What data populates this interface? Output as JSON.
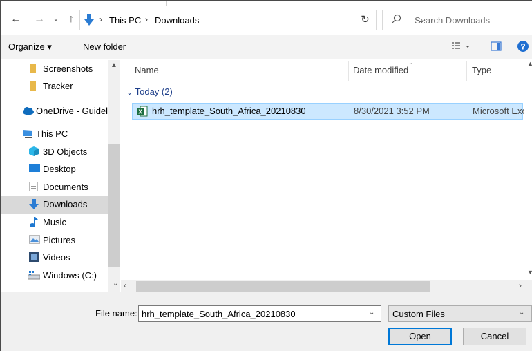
{
  "address_bar": {
    "back_icon": "arrow-left-icon",
    "forward_icon": "arrow-right-icon",
    "recent_icon": "chevron-down-icon",
    "up_icon": "arrow-up-icon",
    "location_icon": "downloads-icon",
    "crumbs": [
      "This PC",
      "Downloads"
    ],
    "separator": "›",
    "dropdown_icon": "chevron-down-icon",
    "refresh_icon": "refresh-icon",
    "refresh_glyph": "↻",
    "search_placeholder": "Search Downloads"
  },
  "toolbar": {
    "organize_label": "Organize ▾",
    "new_folder_label": "New folder",
    "view_icon": "view-options-icon",
    "preview_icon": "preview-pane-icon",
    "help_icon": "help-icon",
    "help_glyph": "?"
  },
  "nav": {
    "items": [
      {
        "label": "Screenshots",
        "icon": "folder-icon"
      },
      {
        "label": "Tracker",
        "icon": "folder-icon"
      },
      {
        "label": "OneDrive - Guidel",
        "icon": "onedrive-icon"
      },
      {
        "label": "This PC",
        "icon": "computer-icon"
      },
      {
        "label": "3D Objects",
        "icon": "3d-objects-icon"
      },
      {
        "label": "Desktop",
        "icon": "desktop-icon"
      },
      {
        "label": "Documents",
        "icon": "documents-icon"
      },
      {
        "label": "Downloads",
        "icon": "downloads-icon",
        "selected": true
      },
      {
        "label": "Music",
        "icon": "music-icon"
      },
      {
        "label": "Pictures",
        "icon": "pictures-icon"
      },
      {
        "label": "Videos",
        "icon": "videos-icon"
      },
      {
        "label": "Windows (C:)",
        "icon": "drive-icon"
      }
    ]
  },
  "file_list": {
    "columns": [
      "Name",
      "Date modified",
      "Type"
    ],
    "groups": [
      {
        "label": "Today (2)",
        "files": [
          {
            "name": "hrh_template_South_Africa_20210830",
            "date": "8/30/2021 3:52 PM",
            "type": "Microsoft Excel",
            "icon": "excel-icon",
            "selected": true
          }
        ]
      }
    ]
  },
  "bottom": {
    "file_name_label": "File name:",
    "file_name_value": "hrh_template_South_Africa_20210830",
    "filter_value": "Custom Files",
    "open_label": "Open",
    "cancel_label": "Cancel"
  },
  "colors": {
    "accent": "#0078d7",
    "selection": "#cce8ff",
    "toolbar_bg": "#f3f3f3",
    "footer_bg": "#f0f0f0"
  }
}
